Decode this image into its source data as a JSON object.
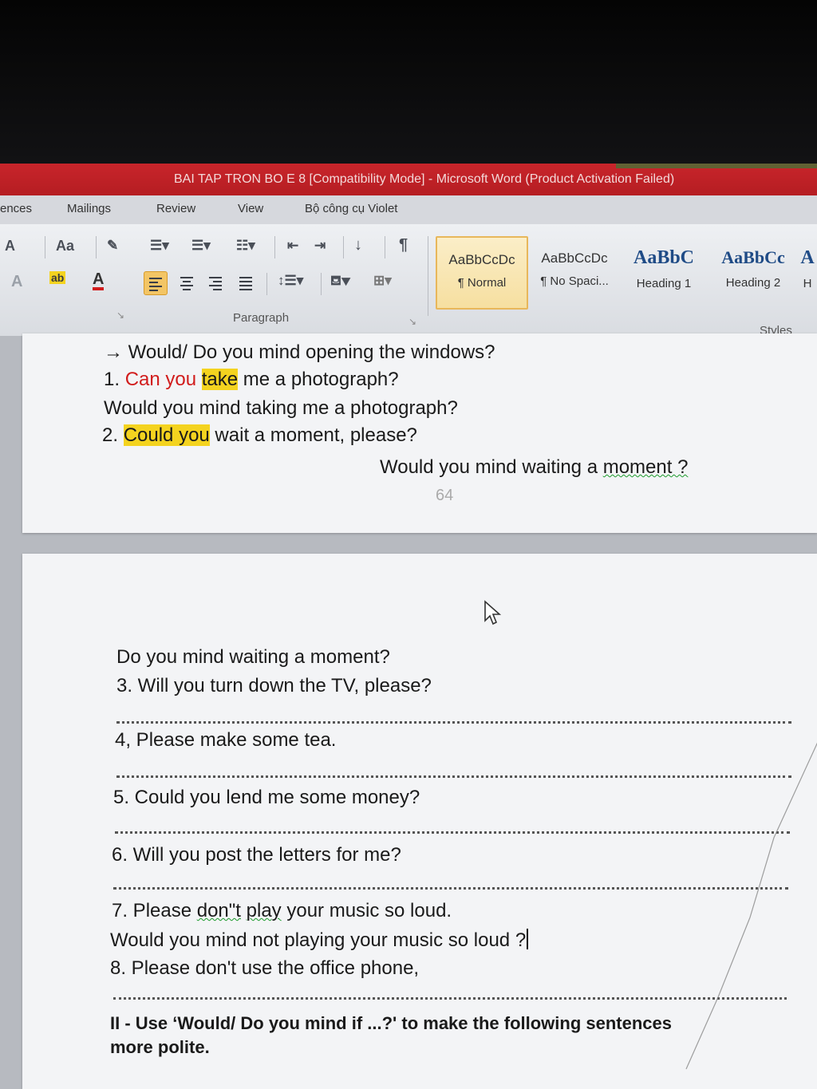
{
  "window": {
    "title": "BAI TAP TRON BO E 8 [Compatibility Mode] - Microsoft Word (Product Activation Failed)"
  },
  "ribbon_tabs": [
    "ences",
    "Mailings",
    "Review",
    "View",
    "Bộ công cụ Violet"
  ],
  "ribbon": {
    "font_glyphs": {
      "grow": "A",
      "case": "Aa",
      "highlight": "ab",
      "color": "A"
    },
    "paragraph_label": "Paragraph",
    "styles_label": "Styles",
    "styles": [
      {
        "sample": "AaBbCcDc",
        "name": "¶ Normal"
      },
      {
        "sample": "AaBbCcDc",
        "name": "¶ No Spaci..."
      },
      {
        "sample": "AaBbC",
        "name": "Heading 1"
      },
      {
        "sample": "AaBbCc",
        "name": "Heading 2"
      },
      {
        "sample": "A",
        "name": "H"
      }
    ]
  },
  "page1": {
    "line0": "→ Would/ Do you mind opening the windows?",
    "q1": {
      "num": "1. ",
      "red": "Can you ",
      "hl": "take",
      "rest": " me a photograph?"
    },
    "a1": "Would you mind taking me a photograph?",
    "q2": {
      "num": "2. ",
      "hl": "Could you",
      "rest": " wait a moment, please?"
    },
    "a2": {
      "pre": "Would you mind waiting a ",
      "squig": "moment ?"
    },
    "page_number": "64"
  },
  "page2": {
    "line_a": "Do you mind waiting a moment?",
    "q3": "3. Will you turn down the TV, please?",
    "q4": "4, Please make some tea.",
    "q5": "5. Could you lend me some money?",
    "q6": "6. Will you post the letters for me?",
    "q7": {
      "pre": "7. Please ",
      "squig1": "don\"t",
      "mid": " ",
      "squig2": "play",
      "rest": " your music so loud."
    },
    "a7": "Would you mind not playing your music so loud ?",
    "q8": "8. Please don't use the office phone,",
    "section2_line1": "II - Use ‘Would/ Do you mind if ...?' to make the following sentences",
    "section2_line2": "more polite."
  },
  "colors": {
    "title_bar": "#c8252b",
    "highlight": "#f4d31f",
    "red_text": "#d11c1c",
    "style_selected": "#f6dfa0"
  }
}
